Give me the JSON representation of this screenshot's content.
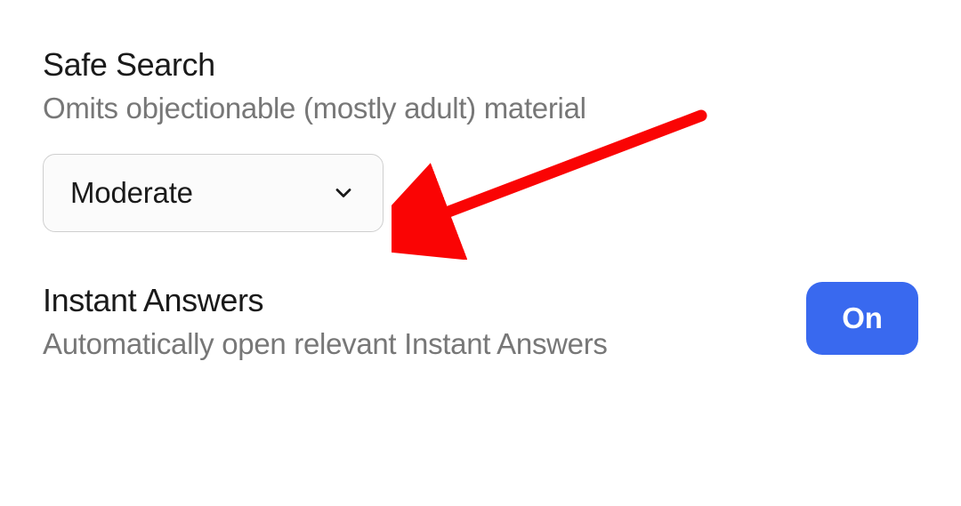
{
  "settings": {
    "safeSearch": {
      "title": "Safe Search",
      "description": "Omits objectionable (mostly adult) material",
      "selectedValue": "Moderate"
    },
    "instantAnswers": {
      "title": "Instant Answers",
      "description": "Automatically open relevant Instant Answers",
      "toggleLabel": "On"
    }
  },
  "colors": {
    "accent": "#3969ef",
    "arrow": "#fa0404"
  }
}
